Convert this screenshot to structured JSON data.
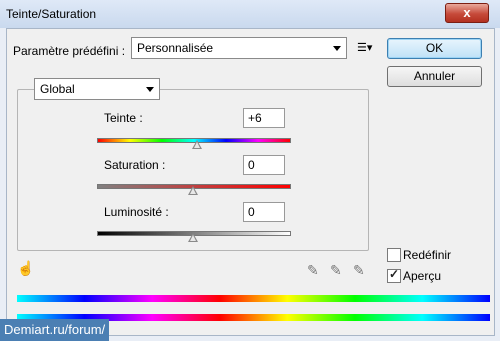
{
  "window": {
    "title": "Teinte/Saturation",
    "close_glyph": "x"
  },
  "preset": {
    "label": "Paramètre prédéfini :",
    "value": "Personnalisée",
    "menu_icon": "list-menu-icon"
  },
  "buttons": {
    "ok": "OK",
    "cancel": "Annuler"
  },
  "channel": {
    "value": "Global"
  },
  "sliders": {
    "hue": {
      "label": "Teinte :",
      "value": "+6",
      "level": 0.52
    },
    "saturation": {
      "label": "Saturation :",
      "value": "0",
      "level": 0.5
    },
    "lightness": {
      "label": "Luminosité :",
      "value": "0",
      "level": 0.5
    }
  },
  "options": {
    "colorize": {
      "label": "Redéfinir",
      "checked": false
    },
    "preview": {
      "label": "Aperçu",
      "checked": true
    }
  },
  "tools": [
    "target-adjust-icon",
    "eyedropper-icon",
    "eyedropper-plus-icon",
    "eyedropper-minus-icon"
  ],
  "watermark": "Demiart.ru/forum/"
}
